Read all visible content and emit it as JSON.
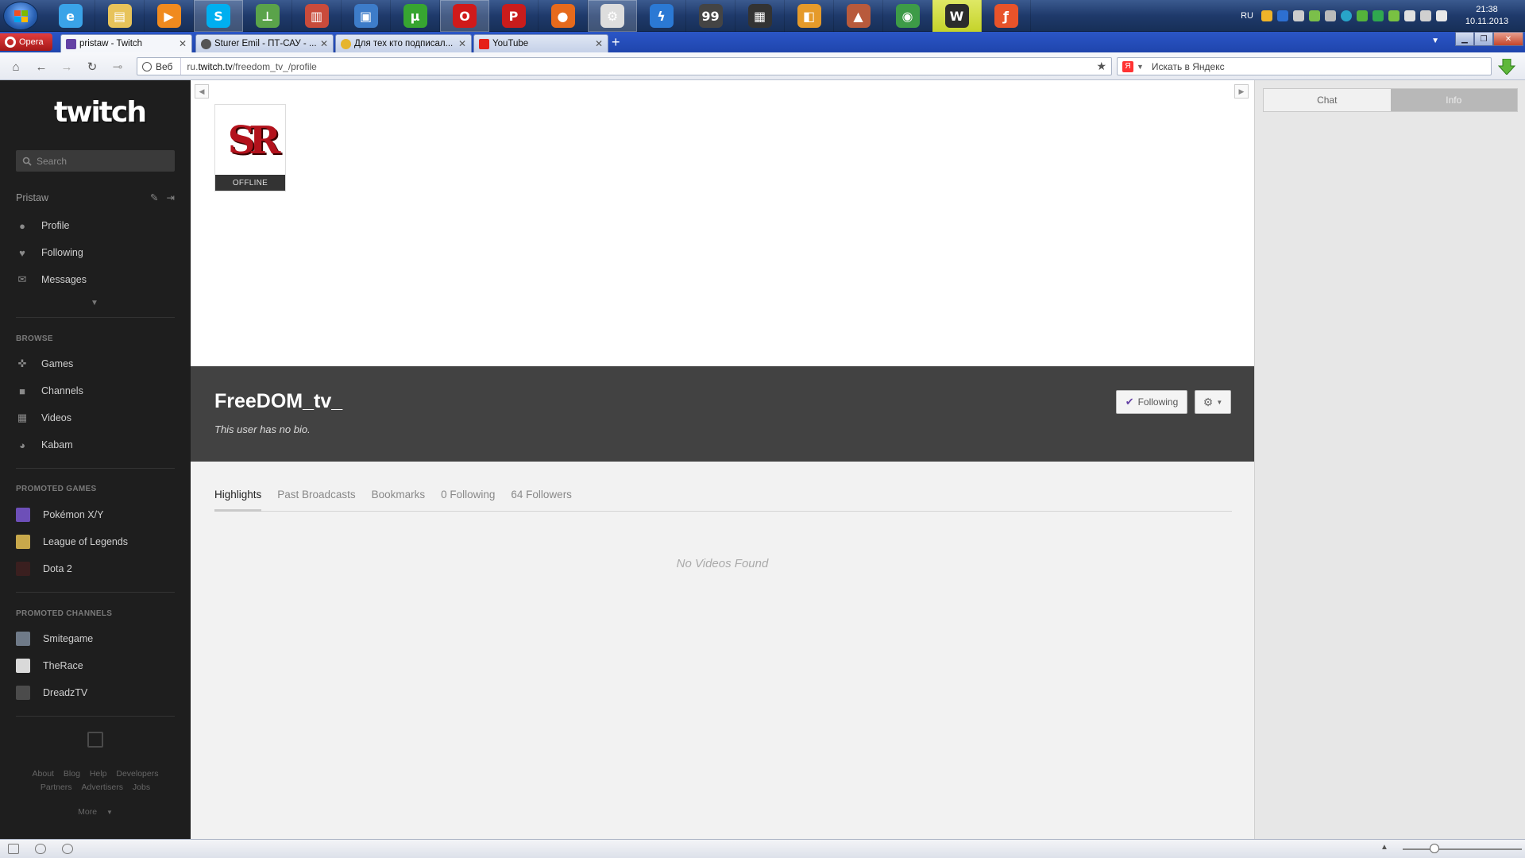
{
  "taskbar": {
    "icons": [
      {
        "name": "ie-icon",
        "color": "#3aa3e8",
        "glyph": "e"
      },
      {
        "name": "explorer-icon",
        "color": "#e7c35a",
        "glyph": "▤"
      },
      {
        "name": "media-player-icon",
        "color": "#f08a1e",
        "glyph": "▶"
      },
      {
        "name": "skype-icon",
        "color": "#00aff0",
        "glyph": "S"
      },
      {
        "name": "network-icon",
        "color": "#5aa34a",
        "glyph": "⊥"
      },
      {
        "name": "books-icon",
        "color": "#c94b3b",
        "glyph": "▥"
      },
      {
        "name": "monitor-icon",
        "color": "#3d7cc9",
        "glyph": "▣"
      },
      {
        "name": "utorrent-icon",
        "color": "#37a531",
        "glyph": "µ"
      },
      {
        "name": "opera-icon",
        "color": "#d01a1a",
        "glyph": "O"
      },
      {
        "name": "ip-icon",
        "color": "#c91c1c",
        "glyph": "P"
      },
      {
        "name": "firefox-icon",
        "color": "#e66a1c",
        "glyph": "●"
      },
      {
        "name": "steam-icon",
        "color": "#ddd",
        "glyph": "⚙"
      },
      {
        "name": "lightning-icon",
        "color": "#2b79d4",
        "glyph": "ϟ"
      },
      {
        "name": "terminal-icon",
        "color": "#444",
        "glyph": "99"
      },
      {
        "name": "film-icon",
        "color": "#333",
        "glyph": "▦"
      },
      {
        "name": "folder-icon",
        "color": "#e59a2a",
        "glyph": "◧"
      },
      {
        "name": "game-icon",
        "color": "#b85a3c",
        "glyph": "▲"
      },
      {
        "name": "chrome-icon",
        "color": "#3d9b47",
        "glyph": "◉"
      },
      {
        "name": "wot-icon",
        "color": "#2c2c2c",
        "glyph": "W"
      },
      {
        "name": "flash-icon",
        "color": "#e8532a",
        "glyph": "ƒ"
      }
    ],
    "language": "RU",
    "time": "21:38",
    "date": "10.11.2013"
  },
  "browser": {
    "menu_label": "Opera",
    "tabs": [
      {
        "title": "pristaw - Twitch",
        "fav_color": "#6441a5",
        "active": true
      },
      {
        "title": "Sturer Emil - ПТ-САУ - ...",
        "fav_color": "#555",
        "active": false
      },
      {
        "title": "Для тех кто подписал...",
        "fav_color": "#e6b52d",
        "active": false
      },
      {
        "title": "YouTube",
        "fav_color": "#e62117",
        "active": false
      }
    ],
    "new_tab": "+",
    "web_label": "Веб",
    "url_prefix": "ru.",
    "url_domain": "twitch.tv",
    "url_path": "/freedom_tv_/profile",
    "search_placeholder": "Искать в Яндекс",
    "search_engine": "Я"
  },
  "sidebar": {
    "logo": "twitch",
    "search_placeholder": "Search",
    "username": "Pristaw",
    "user_items": [
      {
        "label": "Profile",
        "icon": "user-icon"
      },
      {
        "label": "Following",
        "icon": "heart-icon"
      },
      {
        "label": "Messages",
        "icon": "envelope-icon"
      }
    ],
    "browse_heading": "BROWSE",
    "browse_items": [
      {
        "label": "Games",
        "icon": "gamepad-icon"
      },
      {
        "label": "Channels",
        "icon": "camera-icon"
      },
      {
        "label": "Videos",
        "icon": "film-icon"
      },
      {
        "label": "Kabam",
        "icon": "kabam-icon"
      }
    ],
    "promoted_games_heading": "PROMOTED GAMES",
    "promoted_games": [
      {
        "label": "Pokémon X/Y",
        "color": "#6d4fb8"
      },
      {
        "label": "League of Legends",
        "color": "#c8a84b"
      },
      {
        "label": "Dota 2",
        "color": "#3a1f1f"
      }
    ],
    "promoted_channels_heading": "PROMOTED CHANNELS",
    "promoted_channels": [
      {
        "label": "Smitegame",
        "color": "#6f7a88"
      },
      {
        "label": "TheRace",
        "color": "#d9d9d9"
      },
      {
        "label": "DreadzTV",
        "color": "#4b4b4b"
      }
    ],
    "footer_row1": [
      "About",
      "Blog",
      "Help",
      "Developers"
    ],
    "footer_row2": [
      "Partners",
      "Advertisers",
      "Jobs"
    ],
    "more_label": "More"
  },
  "channel": {
    "avatar_text": "SR",
    "status": "OFFLINE",
    "name": "FreeDOM_tv_",
    "bio": "This user has no bio.",
    "follow_label": "Following",
    "tabs": [
      "Highlights",
      "Past Broadcasts",
      "Bookmarks",
      "0 Following",
      "64 Followers"
    ],
    "empty_message": "No Videos Found"
  },
  "chat_panel": {
    "tab_chat": "Chat",
    "tab_info": "Info"
  }
}
